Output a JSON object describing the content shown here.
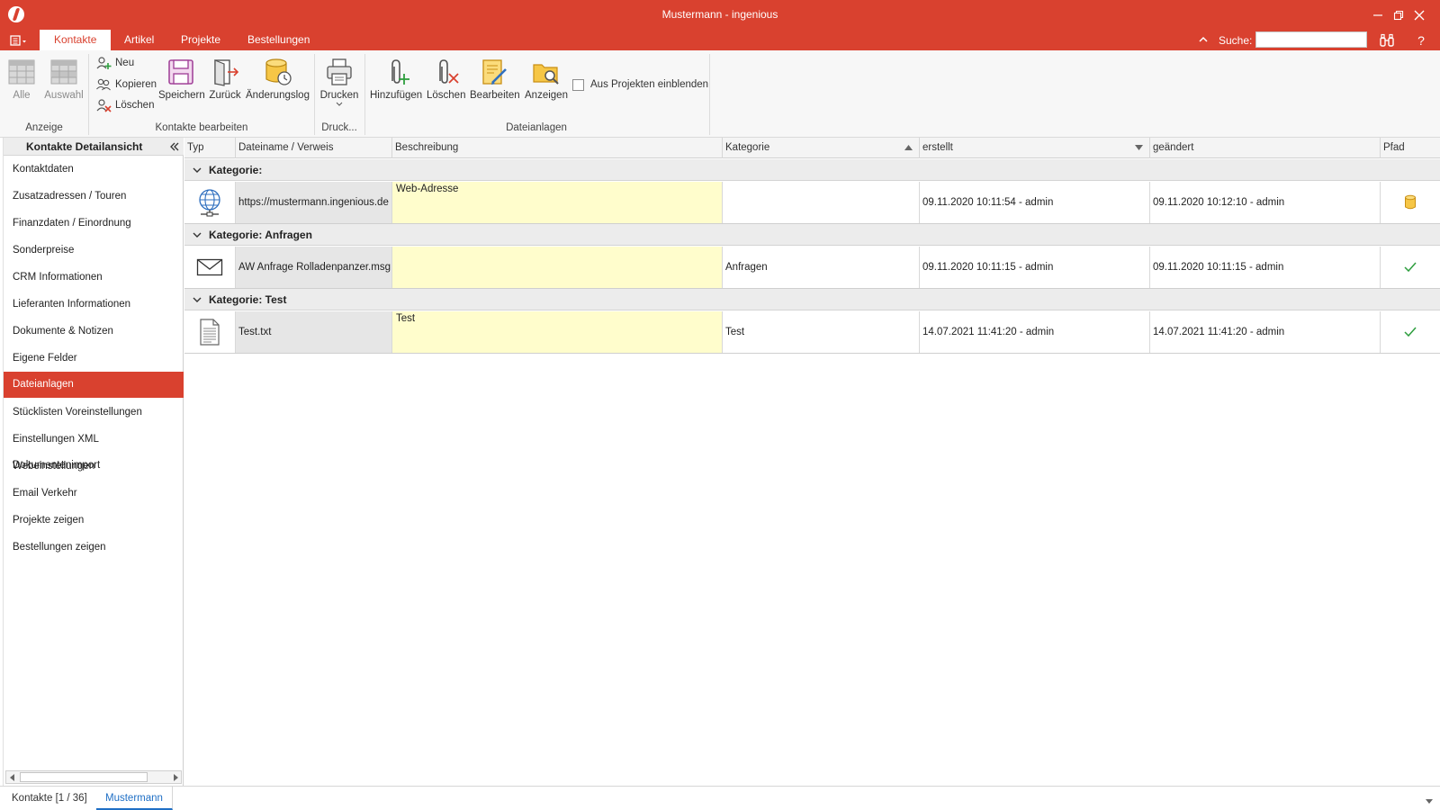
{
  "window": {
    "title": "Mustermann - ingenious",
    "minimize_icon": "minimize-icon",
    "restore_icon": "restore-icon",
    "close_icon": "close-icon"
  },
  "tabs": {
    "items": [
      {
        "label": "Kontakte",
        "active": true
      },
      {
        "label": "Artikel",
        "active": false
      },
      {
        "label": "Projekte",
        "active": false
      },
      {
        "label": "Bestellungen",
        "active": false
      }
    ],
    "search_label": "Suche:",
    "search_value": "",
    "help_label": "?"
  },
  "ribbon": {
    "anzeige": {
      "label": "Anzeige",
      "alle": "Alle",
      "auswahl": "Auswahl"
    },
    "kontakte_bearbeiten": {
      "label": "Kontakte bearbeiten",
      "neu": "Neu",
      "kopieren": "Kopieren",
      "loeschen": "Löschen",
      "speichern": "Speichern",
      "zurueck": "Zurück",
      "aenderungslog": "Änderungslog"
    },
    "druck": {
      "label": "Druck...",
      "drucken": "Drucken"
    },
    "dateianlagen": {
      "label": "Dateianlagen",
      "hinzufuegen": "Hinzufügen",
      "loeschen": "Löschen",
      "bearbeiten": "Bearbeiten",
      "anzeigen": "Anzeigen",
      "aus_projekten": "Aus Projekten einblenden",
      "aus_projekten_checked": false
    }
  },
  "left_panel": {
    "title": "Kontakte Detailansicht",
    "items": [
      {
        "label": "Kontaktdaten",
        "active": false
      },
      {
        "label": "Zusatzadressen / Touren",
        "active": false
      },
      {
        "label": "Finanzdaten / Einordnung",
        "active": false
      },
      {
        "label": "Sonderpreise",
        "active": false
      },
      {
        "label": "CRM Informationen",
        "active": false
      },
      {
        "label": "Lieferanten Informationen",
        "active": false
      },
      {
        "label": "Dokumente & Notizen",
        "active": false
      },
      {
        "label": "Eigene Felder",
        "active": false
      },
      {
        "label": "Dateianlagen",
        "active": true
      },
      {
        "label": "Stücklisten Voreinstellungen",
        "active": false
      },
      {
        "label": "Einstellungen XML Dokumentenimport",
        "active": false
      },
      {
        "label": "Webeinstellungen",
        "active": false
      },
      {
        "label": "Email Verkehr",
        "active": false
      },
      {
        "label": "Projekte zeigen",
        "active": false
      },
      {
        "label": "Bestellungen zeigen",
        "active": false
      }
    ]
  },
  "grid": {
    "columns": {
      "typ": "Typ",
      "dateiname": "Dateiname / Verweis",
      "beschreibung": "Beschreibung",
      "kategorie": "Kategorie",
      "erstellt": "erstellt",
      "geaendert": "geändert",
      "pfad": "Pfad"
    },
    "groups": [
      {
        "label": "Kategorie:",
        "row": {
          "type_icon": "globe-icon",
          "dateiname": "https://mustermann.ingenious.de",
          "beschreibung": "Web-Adresse",
          "kategorie": "",
          "erstellt": "09.11.2020 10:11:54 - admin",
          "geaendert": "09.11.2020 10:12:10 - admin",
          "pfad_icon": "database-icon"
        }
      },
      {
        "label": "Kategorie: Anfragen",
        "row": {
          "type_icon": "envelope-icon",
          "dateiname": "AW Anfrage Rolladenpanzer.msg",
          "beschreibung": "",
          "kategorie": "Anfragen",
          "erstellt": "09.11.2020 10:11:15 - admin",
          "geaendert": "09.11.2020 10:11:15 - admin",
          "pfad_icon": "checkmark-icon"
        }
      },
      {
        "label": "Kategorie: Test",
        "row": {
          "type_icon": "text-file-icon",
          "dateiname": "Test.txt",
          "beschreibung": "Test",
          "kategorie": "Test",
          "erstellt": "14.07.2021 11:41:20 - admin",
          "geaendert": "14.07.2021 11:41:20 - admin",
          "pfad_icon": "checkmark-icon"
        }
      }
    ]
  },
  "bottom_tabs": [
    {
      "label": "Kontakte [1 / 36]",
      "active": false
    },
    {
      "label": "Mustermann",
      "active": true
    }
  ],
  "colors": {
    "accent": "#d9412f",
    "description_bg": "#fffdcc",
    "active_bottom_tab": "#1f6fc5",
    "check": "#2e9e3e"
  }
}
